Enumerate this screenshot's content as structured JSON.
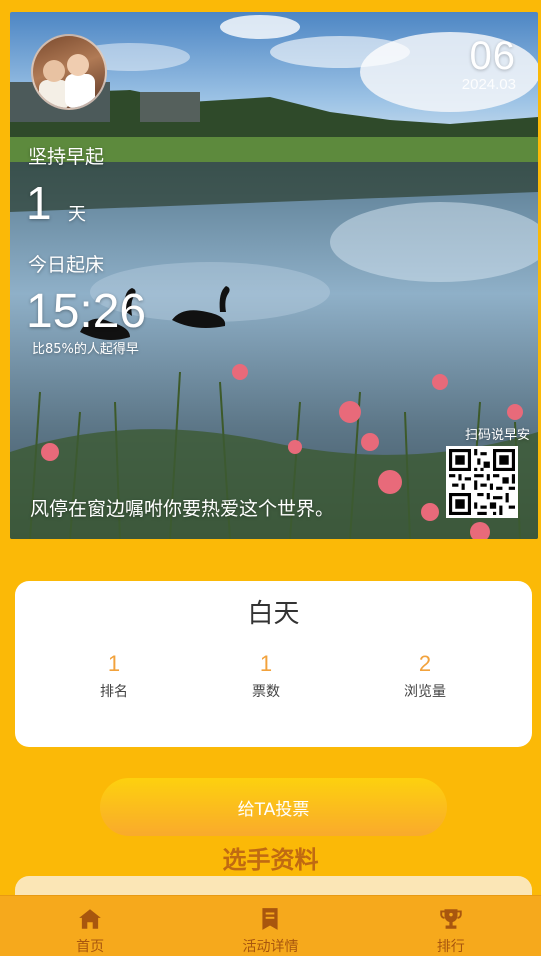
{
  "poster": {
    "date_day": "06",
    "date_year_month": "2024.03",
    "streak_label": "坚持早起",
    "streak_days": "1",
    "streak_unit": "天",
    "today_label": "今日起床",
    "wake_time": "15:26",
    "rank_text": "比85%的人起得早",
    "scan_label": "扫码说早安",
    "quote": "风停在窗边嘱咐你要热爱这个世界。"
  },
  "stats_card": {
    "title": "白天",
    "stats": [
      {
        "value": "1",
        "label": "排名"
      },
      {
        "value": "1",
        "label": "票数"
      },
      {
        "value": "2",
        "label": "浏览量"
      }
    ]
  },
  "vote_button_label": "给TA投票",
  "section_title": "选手资料",
  "tabbar": {
    "items": [
      {
        "label": "首页",
        "icon": "home-icon"
      },
      {
        "label": "活动详情",
        "icon": "document-icon"
      },
      {
        "label": "排行",
        "icon": "trophy-icon"
      }
    ]
  },
  "colors": {
    "background": "#fbb907",
    "accent_number": "#f2a23c",
    "section_title": "#c06a12",
    "tabbar": "#f6a91c",
    "tab_icon": "#a8560e"
  }
}
